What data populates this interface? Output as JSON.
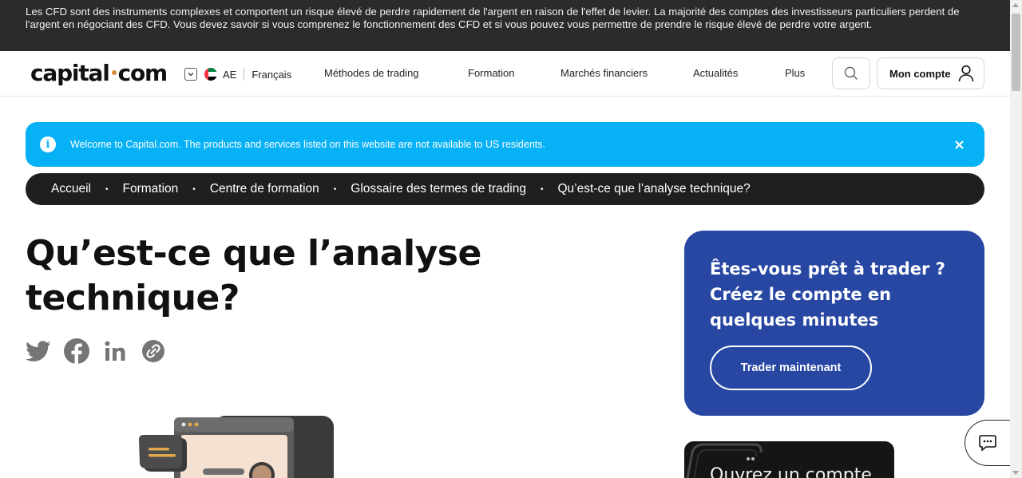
{
  "risk_banner": {
    "text": "Les CFD sont des instruments complexes et comportent un risque élevé de perdre rapidement de l'argent en raison de l'effet de levier. La majorité des comptes des investisseurs particuliers perdent de l'argent en négociant des CFD. Vous devez savoir si vous comprenez le fonctionnement des CFD et si vous pouvez vous permettre de prendre le risque élevé de perdre votre argent."
  },
  "header": {
    "logo_left": "capital",
    "logo_right": "com",
    "region_code": "AE",
    "language": "Français",
    "nav": [
      {
        "label": "Méthodes de trading"
      },
      {
        "label": "Formation"
      },
      {
        "label": "Marchés financiers"
      },
      {
        "label": "Actualités"
      },
      {
        "label": "Plus"
      }
    ],
    "account_label": "Mon compte"
  },
  "info_banner": {
    "text": "Welcome to Capital.com. The products and services listed on this website are not available to US residents."
  },
  "breadcrumb": [
    {
      "label": "Accueil"
    },
    {
      "label": "Formation"
    },
    {
      "label": "Centre de formation"
    },
    {
      "label": "Glossaire des termes de trading"
    },
    {
      "label": "Qu’est-ce que l’analyse technique?"
    }
  ],
  "article": {
    "title": "Qu’est-ce que l’analyse technique?"
  },
  "share_icons": [
    "twitter-icon",
    "facebook-icon",
    "linkedin-icon",
    "copy-link-icon"
  ],
  "cta_card": {
    "heading": "Êtes-vous prêt à trader ? Créez le compte en quelques minutes",
    "button": "Trader maintenant"
  },
  "promo_card": {
    "text": "Ouvrez un compte"
  },
  "colors": {
    "risk_banner_bg": "#2b2b2b",
    "info_banner_bg": "#07b1f5",
    "breadcrumb_bg": "#1f1f1f",
    "cta_bg": "#2747a3",
    "logo_dot": "#d98a3d"
  }
}
